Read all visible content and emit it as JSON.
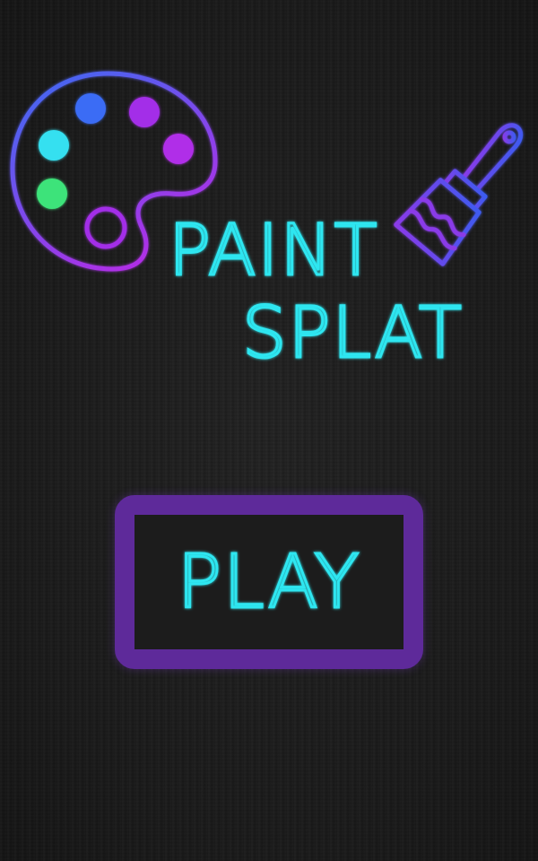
{
  "title": {
    "line1": "PAINT",
    "line2": "SPLAT"
  },
  "play_button": {
    "label": "PLAY"
  },
  "colors": {
    "background": "#1b1b1b",
    "neon_cyan": "#2ee6f0",
    "palette_blue": "#3a6cf5",
    "palette_purple": "#a32ee8",
    "palette_magenta": "#b02ee8",
    "palette_cyan": "#36e0f0",
    "palette_green": "#3ee37a",
    "button_border": "#5e2a9a"
  },
  "icons": [
    "palette-icon",
    "paintbrush-icon"
  ]
}
